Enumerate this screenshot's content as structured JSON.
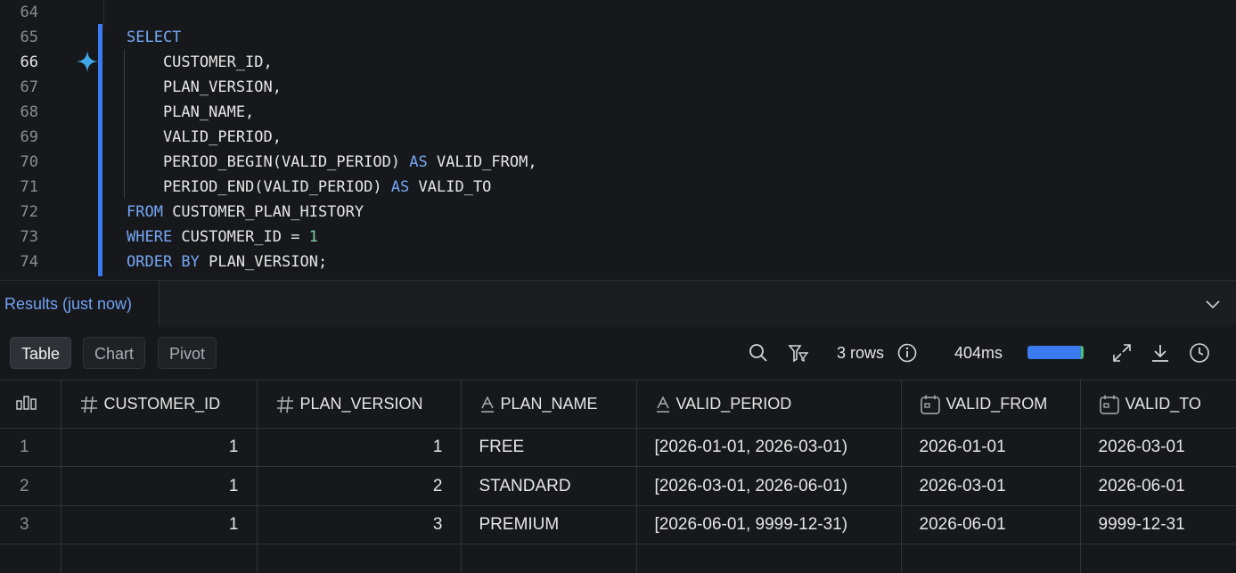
{
  "editor": {
    "lines": [
      {
        "no": "64",
        "active": false,
        "tokens": []
      },
      {
        "no": "65",
        "active": false,
        "tokens": [
          {
            "t": "SELECT",
            "k": "kw"
          }
        ]
      },
      {
        "no": "66",
        "active": true,
        "tokens": [
          {
            "t": "    CUSTOMER_ID,",
            "k": ""
          }
        ]
      },
      {
        "no": "67",
        "active": false,
        "tokens": [
          {
            "t": "    PLAN_VERSION,",
            "k": ""
          }
        ]
      },
      {
        "no": "68",
        "active": false,
        "tokens": [
          {
            "t": "    PLAN_NAME,",
            "k": ""
          }
        ]
      },
      {
        "no": "69",
        "active": false,
        "tokens": [
          {
            "t": "    VALID_PERIOD,",
            "k": ""
          }
        ]
      },
      {
        "no": "70",
        "active": false,
        "tokens": [
          {
            "t": "    PERIOD_BEGIN(VALID_PERIOD) ",
            "k": ""
          },
          {
            "t": "AS",
            "k": "kw"
          },
          {
            "t": " VALID_FROM,",
            "k": ""
          }
        ]
      },
      {
        "no": "71",
        "active": false,
        "tokens": [
          {
            "t": "    PERIOD_END(VALID_PERIOD) ",
            "k": ""
          },
          {
            "t": "AS",
            "k": "kw"
          },
          {
            "t": " VALID_TO",
            "k": ""
          }
        ]
      },
      {
        "no": "72",
        "active": false,
        "tokens": [
          {
            "t": "FROM",
            "k": "kw"
          },
          {
            "t": " CUSTOMER_PLAN_HISTORY",
            "k": ""
          }
        ]
      },
      {
        "no": "73",
        "active": false,
        "tokens": [
          {
            "t": "WHERE",
            "k": "kw"
          },
          {
            "t": " CUSTOMER_ID = ",
            "k": ""
          },
          {
            "t": "1",
            "k": "num"
          }
        ]
      },
      {
        "no": "74",
        "active": false,
        "tokens": [
          {
            "t": "ORDER BY",
            "k": "kw"
          },
          {
            "t": " PLAN_VERSION;",
            "k": ""
          }
        ]
      }
    ]
  },
  "results": {
    "tab_label": "Results (just now)"
  },
  "toolbar": {
    "views": [
      "Table",
      "Chart",
      "Pivot"
    ],
    "active_view": "Table",
    "rows_label": "3 rows",
    "duration": "404ms",
    "progress": 0.95
  },
  "table": {
    "columns": [
      {
        "name": "CUSTOMER_ID",
        "type": "number-icon"
      },
      {
        "name": "PLAN_VERSION",
        "type": "number-icon"
      },
      {
        "name": "PLAN_NAME",
        "type": "text-icon"
      },
      {
        "name": "VALID_PERIOD",
        "type": "text-icon"
      },
      {
        "name": "VALID_FROM",
        "type": "calendar-icon"
      },
      {
        "name": "VALID_TO",
        "type": "calendar-icon"
      }
    ],
    "rows": [
      [
        "1",
        "1",
        "1",
        "FREE",
        "[2026-01-01, 2026-03-01)",
        "2026-01-01",
        "2026-03-01"
      ],
      [
        "2",
        "1",
        "2",
        "STANDARD",
        "[2026-03-01, 2026-06-01)",
        "2026-03-01",
        "2026-06-01"
      ],
      [
        "3",
        "1",
        "3",
        "PREMIUM",
        "[2026-06-01, 9999-12-31)",
        "2026-06-01",
        "9999-12-31"
      ]
    ]
  },
  "colors": {
    "accent": "#3b7bf0",
    "keyword": "#76a7f5",
    "number": "#7fd1a7",
    "sparkle": "#3fa7e8"
  }
}
